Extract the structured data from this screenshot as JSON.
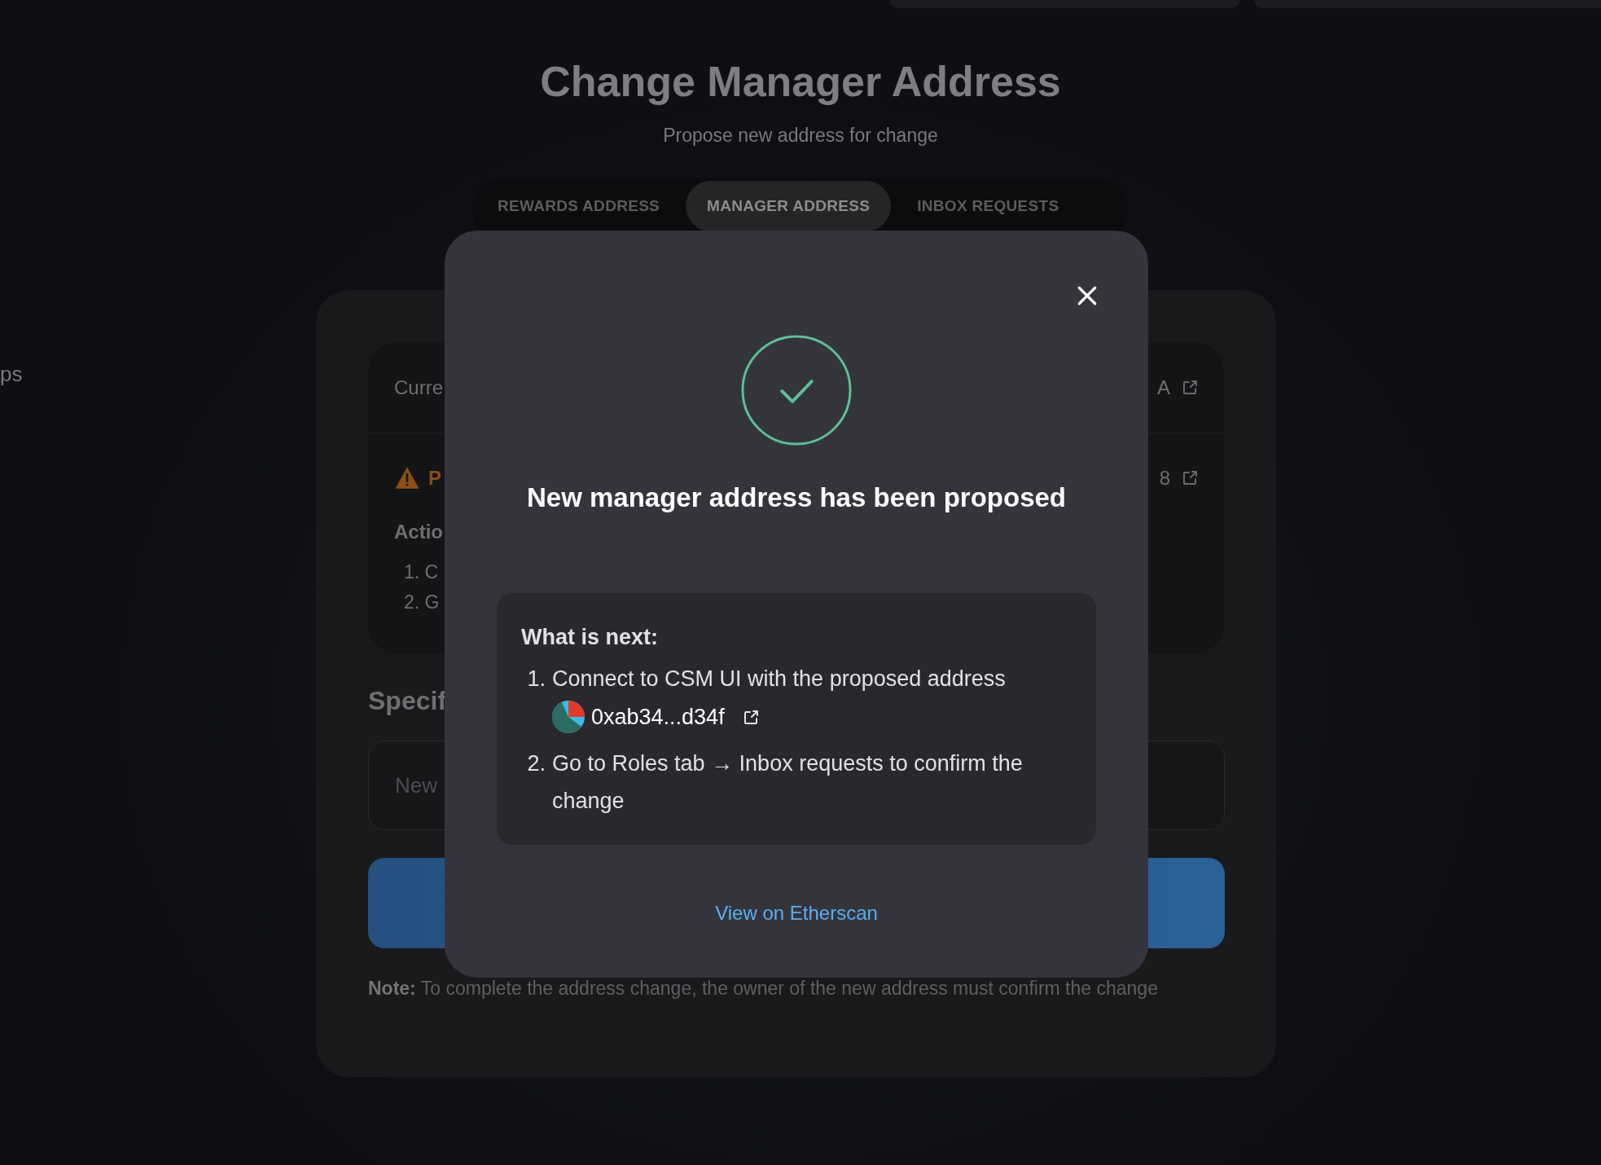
{
  "header": {
    "title": "Change Manager Address",
    "subtitle": "Propose new address for change"
  },
  "tabs": [
    {
      "label": "REWARDS ADDRESS",
      "selected": false
    },
    {
      "label": "MANAGER ADDRESS",
      "selected": true
    },
    {
      "label": "INBOX REQUESTS",
      "selected": false
    }
  ],
  "sidebar": {
    "items": [
      {
        "label": "ps"
      }
    ]
  },
  "current_card": {
    "row_1_label": "Curre",
    "row_1_value": "A",
    "warning_label": "P",
    "row_2_value": "8",
    "actions_title": "Actio",
    "steps": [
      "1. C",
      "2. G"
    ]
  },
  "form": {
    "title": "Specif",
    "input": {
      "placeholder": "New"
    }
  },
  "note": "**Note:** To complete the address change, the owner of the new address must confirm the change",
  "modal": {
    "title": "New manager address has been proposed",
    "next_title": "What is next:",
    "steps": [
      {
        "number": "1.",
        "text": "Connect to CSM UI with the proposed address",
        "address": "0xab34...d34f"
      },
      {
        "number": "2.",
        "text": "Go to Roles tab → Inbox requests to confirm the change"
      }
    ],
    "link": "View on Etherscan"
  }
}
